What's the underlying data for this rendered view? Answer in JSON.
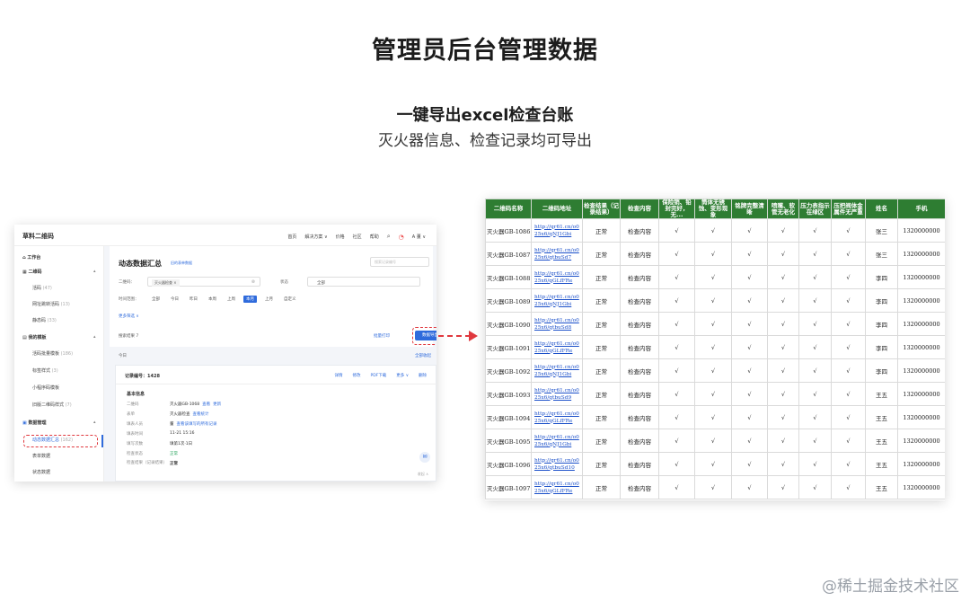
{
  "heading": {
    "title": "管理员后台管理数据",
    "subtitle": "一键导出excel检查台账",
    "description": "灭火器信息、检查记录均可导出"
  },
  "app": {
    "brand": "草料二维码",
    "topnav": [
      "首页",
      "解决方案 ∨",
      "价格",
      "社区",
      "帮助"
    ],
    "user": "A 董 ∨",
    "sidebar": {
      "workbench": "工作台",
      "qrcode_group": "二维码",
      "qrcode_items": [
        {
          "label": "活码",
          "count": "(47)"
        },
        {
          "label": "网址跳转活码",
          "count": "(13)"
        },
        {
          "label": "静态码",
          "count": "(33)"
        }
      ],
      "template_group": "我的模板",
      "template_items": [
        {
          "label": "活码批量模板",
          "count": "(186)"
        },
        {
          "label": "标签样式",
          "count": "(3)"
        },
        {
          "label": "小程序码模板",
          "count": ""
        },
        {
          "label": "旧版二维码样式",
          "count": "(7)"
        }
      ],
      "data_group": "数据管理",
      "data_items": [
        {
          "label": "动态数据汇总",
          "count": "(162)"
        },
        {
          "label": "表单数据",
          "count": ""
        },
        {
          "label": "状态数据",
          "count": ""
        }
      ]
    },
    "main": {
      "title": "动态数据汇总",
      "title_link": "旧的表单数据",
      "search_placeholder": "搜索记录编号",
      "filter_qrcode_label": "二维码：",
      "filter_qrcode_tag": "灭火器检查 ×",
      "filter_status_label": "状态",
      "filter_status_value": "全部",
      "time_label": "时间范围：",
      "time_options": [
        "全部",
        "今日",
        "昨日",
        "本周",
        "上周",
        "本月",
        "上月",
        "自定义"
      ],
      "time_selected": "本月",
      "more_filter": "更多筛选 ∨",
      "summary": "搜索结果 7",
      "batch_print": "批量打印",
      "export_button": "数据导出",
      "list_day": "今日",
      "expand_all": "全部收起",
      "record_no": "记录编号：1428",
      "card_ops": [
        "详情",
        "修改",
        "PDF下载",
        "更多 ∨",
        "删除"
      ],
      "info_title": "基本信息",
      "info": [
        {
          "k": "二维码",
          "v": "灭火器GB-1068",
          "links": [
            "查看",
            "更新"
          ]
        },
        {
          "k": "表单",
          "v": "灭火器检查",
          "links": [
            "查看统计"
          ]
        },
        {
          "k": "填表人员",
          "v": "董",
          "links": [
            "查看该填写的所有记录"
          ]
        },
        {
          "k": "填表时间",
          "v": "11-21 15:16",
          "links": []
        },
        {
          "k": "填写次数",
          "v": "填第1次·1日",
          "links": []
        },
        {
          "k": "检查状态",
          "v": "正常",
          "links": []
        },
        {
          "k": "检查结果（记录结果）",
          "v": "正常",
          "links": []
        }
      ],
      "collapse_text": "收起 ∧"
    }
  },
  "sheet": {
    "headers": [
      "二维码名称",
      "二维码地址",
      "检查结果（记录结果）",
      "检查内容",
      "保险销、铅封完好，无...",
      "筒体无锈蚀、变形现象",
      "铭牌完整清晰",
      "喷嘴、软管无老化",
      "压力表指示在绿区",
      "压把阀体金属件无严重",
      "姓名",
      "手机"
    ],
    "rows": [
      [
        "灭火器GB-1086",
        "http://qr61.cn/o025x6/qNJ1Gbi",
        "正常",
        "检查内容",
        "√",
        "√",
        "√",
        "√",
        "√",
        "√",
        "张三",
        "1320000000"
      ],
      [
        "灭火器GB-1087",
        "http://qr61.cn/o025x6/qtbuSd7",
        "正常",
        "检查内容",
        "√",
        "√",
        "√",
        "√",
        "√",
        "√",
        "张三",
        "1320000000"
      ],
      [
        "灭火器GB-1088",
        "http://qr61.cn/o025x6/qGLfFRe",
        "正常",
        "检查内容",
        "√",
        "√",
        "√",
        "√",
        "√",
        "√",
        "李四",
        "1320000000"
      ],
      [
        "灭火器GB-1089",
        "http://qr61.cn/o025x6/qNJ1Gbi",
        "正常",
        "检查内容",
        "√",
        "√",
        "√",
        "√",
        "√",
        "√",
        "李四",
        "1320000000"
      ],
      [
        "灭火器GB-1090",
        "http://qr61.cn/o025x6/qtbuSd8",
        "正常",
        "检查内容",
        "√",
        "√",
        "√",
        "√",
        "√",
        "√",
        "李四",
        "1320000000"
      ],
      [
        "灭火器GB-1091",
        "http://qr61.cn/o025x6/qGLfFRe",
        "正常",
        "检查内容",
        "√",
        "√",
        "√",
        "√",
        "√",
        "√",
        "李四",
        "1320000000"
      ],
      [
        "灭火器GB-1092",
        "http://qr61.cn/o025x6/qNJ1Gbi",
        "正常",
        "检查内容",
        "√",
        "√",
        "√",
        "√",
        "√",
        "√",
        "李四",
        "1320000000"
      ],
      [
        "灭火器GB-1093",
        "http://qr61.cn/o025x6/qtbuSd9",
        "正常",
        "检查内容",
        "√",
        "√",
        "√",
        "√",
        "√",
        "√",
        "王五",
        "1320000000"
      ],
      [
        "灭火器GB-1094",
        "http://qr61.cn/o025x6/qGLfFRe",
        "正常",
        "检查内容",
        "√",
        "√",
        "√",
        "√",
        "√",
        "√",
        "王五",
        "1320000000"
      ],
      [
        "灭火器GB-1095",
        "http://qr61.cn/o025x6/qNJ1Gbi",
        "正常",
        "检查内容",
        "√",
        "√",
        "√",
        "√",
        "√",
        "√",
        "王五",
        "1320000000"
      ],
      [
        "灭火器GB-1096",
        "http://qr61.cn/o025x6/qtbuSd10",
        "正常",
        "检查内容",
        "√",
        "√",
        "√",
        "√",
        "√",
        "√",
        "王五",
        "1320000000"
      ],
      [
        "灭火器GB-1097",
        "http://qr61.cn/o025x6/qGLfFRe",
        "正常",
        "检查内容",
        "√",
        "√",
        "√",
        "√",
        "√",
        "√",
        "王五",
        "1320000000"
      ]
    ],
    "header_color": "#2e7d32",
    "link_color": "#1a4fc9"
  },
  "watermark": "@稀土掘金技术社区",
  "colors": {
    "accent": "#2f6bdc",
    "highlight": "#e0383e"
  }
}
